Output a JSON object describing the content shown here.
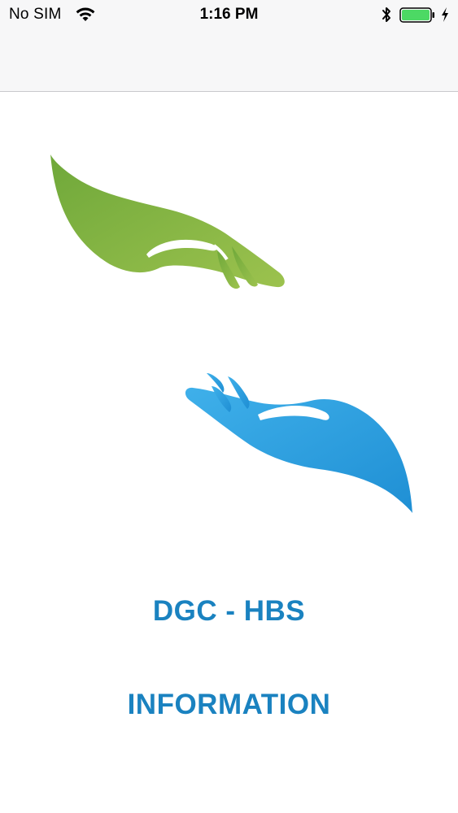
{
  "status_bar": {
    "carrier": "No SIM",
    "time": "1:16 PM",
    "wifi_icon": "wifi-icon",
    "bluetooth_icon": "bluetooth-icon",
    "battery_icon": "battery-icon",
    "charging_icon": "charging-bolt-icon",
    "battery_color": "#4cd964"
  },
  "logo": {
    "top_hand_icon": "green-hand-icon",
    "bottom_hand_icon": "blue-hand-icon",
    "top_hand_color": "#7db443",
    "bottom_hand_color": "#2b9ee0"
  },
  "main": {
    "title_line_1": "DGC - HBS",
    "title_line_2": "INFORMATION",
    "title_color": "#1a82c0"
  }
}
